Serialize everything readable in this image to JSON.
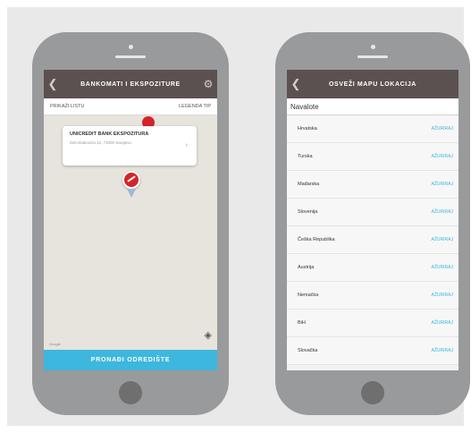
{
  "phone1": {
    "title": "BANKOMATI I EKSPOZITURE",
    "back_icon": "back-arrow-icon",
    "settings_icon": "gear-icon",
    "list_link": "PRIKAŽI LISTU",
    "legend_link": "LEGENDA TIP",
    "popup": {
      "title": "UNICREDIT BANK EKSPOZITURA",
      "subtitle": "Zelo-Đakovića 12, 71000 Sarajevo"
    },
    "map_brand": "Google",
    "locate_icon": "crosshair-icon",
    "bottom_button": "PRONAĐI ODREDIŠTE",
    "colors": {
      "topbar": "#5b5150",
      "accent": "#3db7dd",
      "pin": "#d6232a"
    }
  },
  "phone2": {
    "title": "OSVEŽI MAPU LOKACIJA",
    "back_icon": "back-arrow-icon",
    "section": "Navalote",
    "action_label": "AŽURIRAJ",
    "countries": [
      "Hrvatska",
      "Turska",
      "Mađarska",
      "Slovenija",
      "Češka Republika",
      "Austrija",
      "Nemačka",
      "BiH",
      "Slovačka"
    ]
  }
}
